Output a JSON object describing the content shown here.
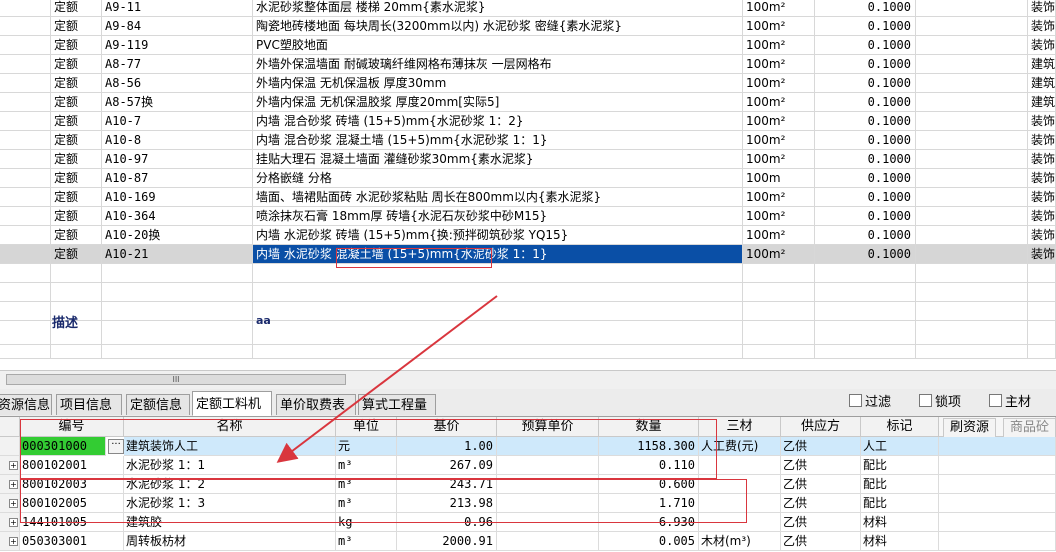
{
  "top_table": {
    "rows": [
      {
        "type": "定额",
        "code": "A9-11",
        "name": "水泥砂浆整体面层 楼梯 20mm{素水泥浆}",
        "unit": "100m²",
        "qty": "0.1000",
        "spec": "装饰"
      },
      {
        "type": "定额",
        "code": "A9-84",
        "name": "陶瓷地砖楼地面 每块周长(3200mm以内) 水泥砂浆 密缝{素水泥浆}",
        "unit": "100m²",
        "qty": "0.1000",
        "spec": "装饰"
      },
      {
        "type": "定额",
        "code": "A9-119",
        "name": "PVC塑胶地面",
        "unit": "100m²",
        "qty": "0.1000",
        "spec": "装饰"
      },
      {
        "type": "定额",
        "code": "A8-77",
        "name": "外墙外保温墙面 耐碱玻璃纤维网格布薄抹灰 一层网格布",
        "unit": "100m²",
        "qty": "0.1000",
        "spec": "建筑"
      },
      {
        "type": "定额",
        "code": "A8-56",
        "name": "外墙内保温 无机保温板 厚度30mm",
        "unit": "100m²",
        "qty": "0.1000",
        "spec": "建筑"
      },
      {
        "type": "定额",
        "code": "A8-57换",
        "name": "外墙内保温 无机保温胶浆 厚度20mm[实际5]",
        "unit": "100m²",
        "qty": "0.1000",
        "spec": "建筑"
      },
      {
        "type": "定额",
        "code": "A10-7",
        "name": "内墙 混合砂浆 砖墙 (15+5)mm{水泥砂浆 1：2}",
        "unit": "100m²",
        "qty": "0.1000",
        "spec": "装饰"
      },
      {
        "type": "定额",
        "code": "A10-8",
        "name": "内墙 混合砂浆 混凝土墙 (15+5)mm{水泥砂浆 1：1}",
        "unit": "100m²",
        "qty": "0.1000",
        "spec": "装饰"
      },
      {
        "type": "定额",
        "code": "A10-97",
        "name": "挂贴大理石 混凝土墙面 灌缝砂浆30mm{素水泥浆}",
        "unit": "100m²",
        "qty": "0.1000",
        "spec": "装饰"
      },
      {
        "type": "定额",
        "code": "A10-87",
        "name": "分格嵌缝 分格",
        "unit": "100m",
        "qty": "0.1000",
        "spec": "装饰"
      },
      {
        "type": "定额",
        "code": "A10-169",
        "name": "墙面、墙裙贴面砖 水泥砂浆粘贴 周长在800mm以内{素水泥浆}",
        "unit": "100m²",
        "qty": "0.1000",
        "spec": "装饰"
      },
      {
        "type": "定额",
        "code": "A10-364",
        "name": "喷涂抹灰石膏 18mm厚 砖墙{水泥石灰砂浆中砂M15}",
        "unit": "100m²",
        "qty": "0.1000",
        "spec": "装饰"
      },
      {
        "type": "定额",
        "code": "A10-20换",
        "name": "内墙 水泥砂浆 砖墙 (15+5)mm{换:预拌砌筑砂浆 YQ15}",
        "unit": "100m²",
        "qty": "0.1000",
        "spec": "装饰"
      },
      {
        "type": "定额",
        "code": "A10-21",
        "name": "内墙 水泥砂浆 混凝土墙 (15+5)mm{水泥砂浆 1：1}",
        "unit": "100m²",
        "qty": "0.1000",
        "spec": "装饰"
      }
    ],
    "desc_label": "描述",
    "desc_value": "aa",
    "scroll_glyph": "III"
  },
  "tabs": [
    {
      "label": "资源信息"
    },
    {
      "label": "项目信息"
    },
    {
      "label": "定额信息"
    },
    {
      "label": "定额工料机"
    },
    {
      "label": "单价取费表"
    },
    {
      "label": "算式工程量"
    }
  ],
  "checkboxes": [
    {
      "label": "过滤"
    },
    {
      "label": "锁项"
    },
    {
      "label": "主材"
    }
  ],
  "bottom_table": {
    "headers": [
      "编号",
      "名称",
      "单位",
      "基价",
      "预算单价",
      "数量",
      "三材",
      "供应方",
      "标记"
    ],
    "right_buttons": [
      "刷资源",
      "商品砼"
    ],
    "rows": [
      {
        "code": "000301000",
        "name": "建筑装饰人工",
        "unit": "元",
        "base": "1.00",
        "budget": "",
        "qty": "1158.300",
        "mat": "人工费(元)",
        "supplier": "乙供",
        "mark": "人工"
      },
      {
        "code": "800102001",
        "name": "水泥砂浆 1：1",
        "unit": "m³",
        "base": "267.09",
        "budget": "",
        "qty": "0.110",
        "mat": "",
        "supplier": "乙供",
        "mark": "配比"
      },
      {
        "code": "800102003",
        "name": "水泥砂浆 1：2",
        "unit": "m³",
        "base": "243.71",
        "budget": "",
        "qty": "0.600",
        "mat": "",
        "supplier": "乙供",
        "mark": "配比"
      },
      {
        "code": "800102005",
        "name": "水泥砂浆 1：3",
        "unit": "m³",
        "base": "213.98",
        "budget": "",
        "qty": "1.710",
        "mat": "",
        "supplier": "乙供",
        "mark": "配比"
      },
      {
        "code": "144101005",
        "name": "建筑胶",
        "unit": "kg",
        "base": "0.96",
        "budget": "",
        "qty": "6.930",
        "mat": "",
        "supplier": "乙供",
        "mark": "材料"
      },
      {
        "code": "050303001",
        "name": "周转板枋材",
        "unit": "m³",
        "base": "2000.91",
        "budget": "",
        "qty": "0.005",
        "mat": "木材(m³)",
        "supplier": "乙供",
        "mark": "材料"
      }
    ]
  },
  "colors": {
    "selection": "#0a4fa6",
    "highlight_code": "#33cc33",
    "annotation": "#d9363e",
    "first_row_bg": "#cfe9fb"
  }
}
